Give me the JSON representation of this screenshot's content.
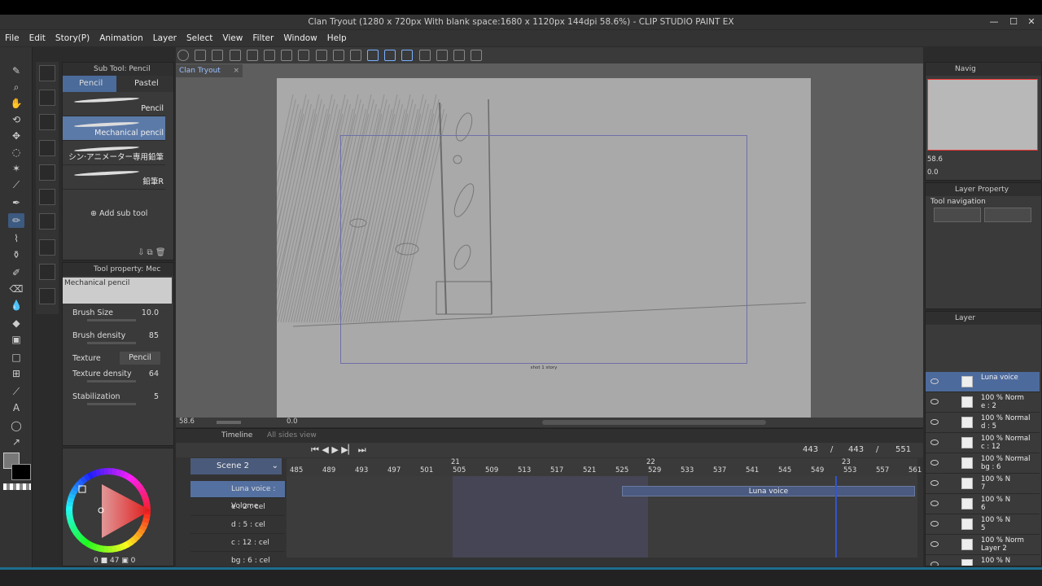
{
  "window": {
    "title": "Clan Tryout (1280 x 720px With blank space:1680 x 1120px 144dpi 58.6%) - CLIP STUDIO PAINT EX",
    "min_icon": "minimize-icon",
    "max_icon": "maximize-icon",
    "close_icon": "close-icon"
  },
  "menu": [
    "File",
    "Edit",
    "Story(P)",
    "Animation",
    "Layer",
    "Select",
    "View",
    "Filter",
    "Window",
    "Help"
  ],
  "document_tab": {
    "label": "Clan Tryout",
    "close": "×"
  },
  "subtool": {
    "title": "Sub Tool: Pencil",
    "tabs": [
      "Pencil",
      "Pastel"
    ],
    "brushes": [
      "Pencil",
      "Mechanical pencil",
      "シン·アニメーター専用鉛筆",
      "鉛筆R"
    ],
    "selected_brush": "Mechanical pencil",
    "add_label": "Add sub tool"
  },
  "toolprop": {
    "title": "Tool property: Mec",
    "preview_label": "Mechanical pencil",
    "brush_size_label": "Brush Size",
    "brush_size_value": "10.0",
    "brush_density_label": "Brush density",
    "brush_density_value": "85",
    "texture_label": "Texture",
    "texture_value": "Pencil",
    "texture_density_label": "Texture density",
    "texture_density_value": "64",
    "stabilization_label": "Stabilization",
    "stabilization_value": "5"
  },
  "color": {
    "fg": "#7a7a7a",
    "bg": "#000000",
    "readout_a": "0",
    "readout_b": "47",
    "readout_c": "0"
  },
  "canvas": {
    "frame_label": "shot 1 story",
    "zoom": "58.6",
    "angle": "0.0"
  },
  "timeline": {
    "title": "Timeline",
    "subtitle": "All sides view",
    "scene": "Scene 2",
    "frame_current": "443",
    "frame_total_a": "443",
    "frame_total_b": "551",
    "ruler_ticks": [
      "485",
      "489",
      "493",
      "497",
      "501",
      "505",
      "509",
      "513",
      "517",
      "521",
      "525",
      "529",
      "533",
      "537",
      "541",
      "545",
      "549",
      "553",
      "557",
      "561"
    ],
    "section_markers": [
      "21",
      "22",
      "23"
    ],
    "tracks": [
      {
        "name": "Luna voice : Volume",
        "selected": true
      },
      {
        "name": "e : 2 : cel",
        "selected": false
      },
      {
        "name": "d : 5 : cel",
        "selected": false
      },
      {
        "name": "c : 12 : cel",
        "selected": false
      },
      {
        "name": "bg : 6 : cel",
        "selected": false
      }
    ],
    "audio_clip_label": "Luna voice"
  },
  "navigator": {
    "title": "Navig",
    "zoom": "58.6",
    "angle": "0.0"
  },
  "layerprop": {
    "title": "Layer Property",
    "subtitle": "Tool navigation"
  },
  "layers": {
    "title": "Layer",
    "rows": [
      {
        "line1": "Luna voice",
        "line2": "",
        "selected": true
      },
      {
        "line1": "100 % Norm",
        "line2": "e : 2",
        "selected": false
      },
      {
        "line1": "100 % Normal",
        "line2": "d : 5",
        "selected": false
      },
      {
        "line1": "100 % Normal",
        "line2": "c : 12",
        "selected": false
      },
      {
        "line1": "100 % Normal",
        "line2": "bg : 6",
        "selected": false
      },
      {
        "line1": "100 % N",
        "line2": "7",
        "selected": false
      },
      {
        "line1": "100 % N",
        "line2": "6",
        "selected": false
      },
      {
        "line1": "100 % N",
        "line2": "5",
        "selected": false
      },
      {
        "line1": "100 % Norm",
        "line2": "Layer 2",
        "selected": false
      },
      {
        "line1": "100 % N",
        "line2": "",
        "selected": false
      }
    ]
  }
}
